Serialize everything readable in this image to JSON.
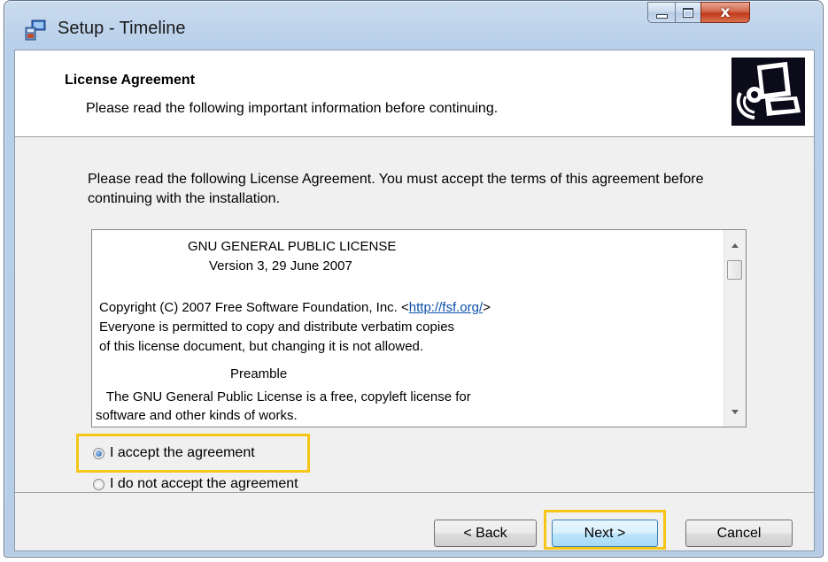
{
  "window": {
    "title": "Setup - Timeline",
    "close_glyph": "x",
    "icon": "setup-icon"
  },
  "header": {
    "title": "License Agreement",
    "subtitle": "Please read the following important information before continuing."
  },
  "intro": "Please read the following License Agreement. You must accept the terms of this agreement before continuing with the installation.",
  "license": {
    "lines": [
      "GNU GENERAL PUBLIC LICENSE",
      "Version 3, 29 June 2007",
      "Copyright (C) 2007 Free Software Foundation, Inc. <",
      "http://fsf.org/",
      ">",
      "Everyone is permitted to copy and distribute verbatim copies",
      "of this license document, but changing it is not allowed.",
      "Preamble",
      " The GNU General Public License is a free, copyleft license for",
      "software and other kinds of works."
    ]
  },
  "options": {
    "accept": "I accept the agreement",
    "decline": "I do not accept the agreement",
    "selected": "accept"
  },
  "buttons": {
    "back": "< Back",
    "next": "Next >",
    "cancel": "Cancel"
  },
  "colors": {
    "highlight": "#f5c518",
    "link": "#0b4fa8"
  }
}
